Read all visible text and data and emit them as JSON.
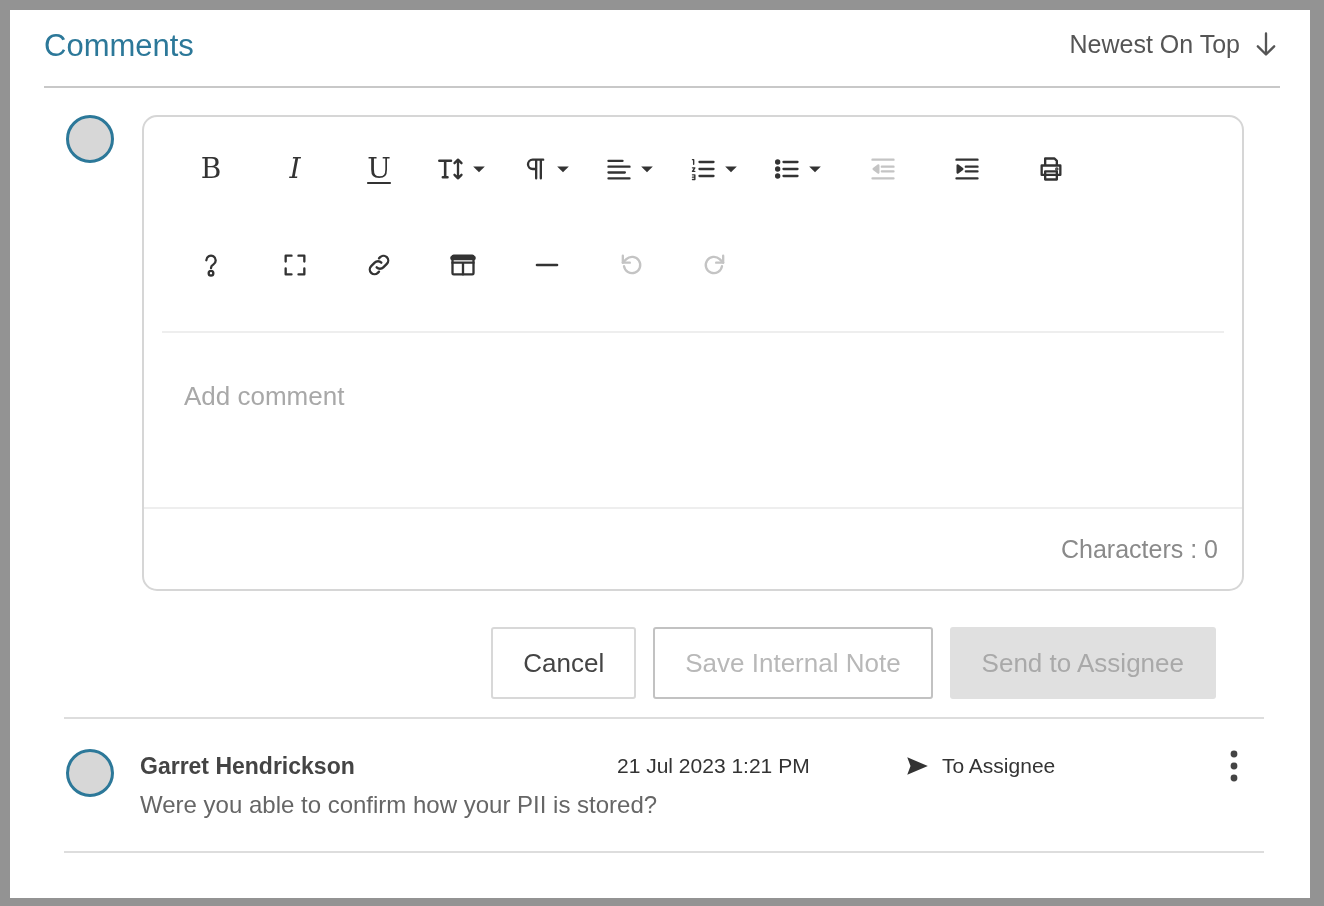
{
  "header": {
    "title": "Comments",
    "sort_label": "Newest On Top"
  },
  "toolbar": {
    "rows": [
      [
        {
          "kind": "bold",
          "glyph": "B",
          "dropdown": false,
          "disabled": false
        },
        {
          "kind": "italic",
          "glyph": "I",
          "dropdown": false,
          "disabled": false
        },
        {
          "kind": "underline",
          "glyph": "U",
          "dropdown": false,
          "disabled": false
        },
        {
          "kind": "font-size",
          "dropdown": true,
          "disabled": false
        },
        {
          "kind": "paragraph",
          "dropdown": true,
          "disabled": false
        },
        {
          "kind": "align",
          "dropdown": true,
          "disabled": false
        },
        {
          "kind": "ordered-list",
          "dropdown": true,
          "disabled": false
        },
        {
          "kind": "bullet-list",
          "dropdown": true,
          "disabled": false
        },
        {
          "kind": "outdent",
          "dropdown": false,
          "disabled": true
        },
        {
          "kind": "indent",
          "dropdown": false,
          "disabled": false
        },
        {
          "kind": "print",
          "dropdown": false,
          "disabled": false
        }
      ],
      [
        {
          "kind": "help",
          "dropdown": false,
          "disabled": false
        },
        {
          "kind": "fullscreen",
          "dropdown": false,
          "disabled": false
        },
        {
          "kind": "link",
          "dropdown": false,
          "disabled": false
        },
        {
          "kind": "table",
          "dropdown": false,
          "disabled": false
        },
        {
          "kind": "rule",
          "dropdown": false,
          "disabled": false
        },
        {
          "kind": "undo",
          "dropdown": false,
          "disabled": true
        },
        {
          "kind": "redo",
          "dropdown": false,
          "disabled": true
        }
      ]
    ]
  },
  "editor": {
    "placeholder": "Add comment",
    "char_count": "Characters : 0"
  },
  "buttons": [
    {
      "label": "Cancel",
      "kind": "outline",
      "disabled": false
    },
    {
      "label": "Save Internal Note",
      "kind": "outline",
      "disabled": true
    },
    {
      "label": "Send to Assignee",
      "kind": "filled",
      "disabled": true
    }
  ],
  "comments": [
    {
      "author": "Garret Hendrickson",
      "time": "21 Jul 2023 1:21 PM",
      "audience": "To Assignee",
      "text": "Were you able to confirm how your PII is stored?"
    }
  ]
}
